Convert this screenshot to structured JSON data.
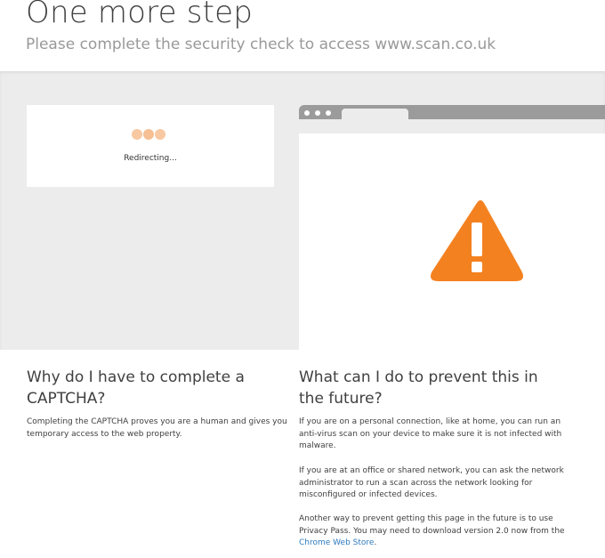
{
  "header": {
    "title": "One more step",
    "subtitle": "Please complete the security check to access www.scan.co.uk"
  },
  "captcha": {
    "status_text": "Redirecting..."
  },
  "illustration": {
    "icon": "warning-triangle-icon",
    "accent_color": "#f48120"
  },
  "why": {
    "heading_line1": "Why do I have to complete a",
    "heading_line2": "CAPTCHA?",
    "body_line1": "Completing the CAPTCHA proves you are a human and gives you",
    "body_line2": "temporary access to the web property."
  },
  "prevent": {
    "heading_line1": "What can I do to prevent this in",
    "heading_line2": "the future?",
    "p1_line1": "If you are on a personal connection, like at home, you can run an",
    "p1_line2": "anti-virus scan on your device to make sure it is not infected with",
    "p1_line3": "malware.",
    "p2_line1": "If you are at an office or shared network, you can ask the network",
    "p2_line2": "administrator to run a scan across the network looking for",
    "p2_line3": "misconfigured or infected devices.",
    "p3_line1": "Another way to prevent getting this page in the future is to use",
    "p3_line2": "Privacy Pass. You may need to download version 2.0 now from the",
    "p3_link": "Chrome Web Store",
    "p3_end": "."
  }
}
